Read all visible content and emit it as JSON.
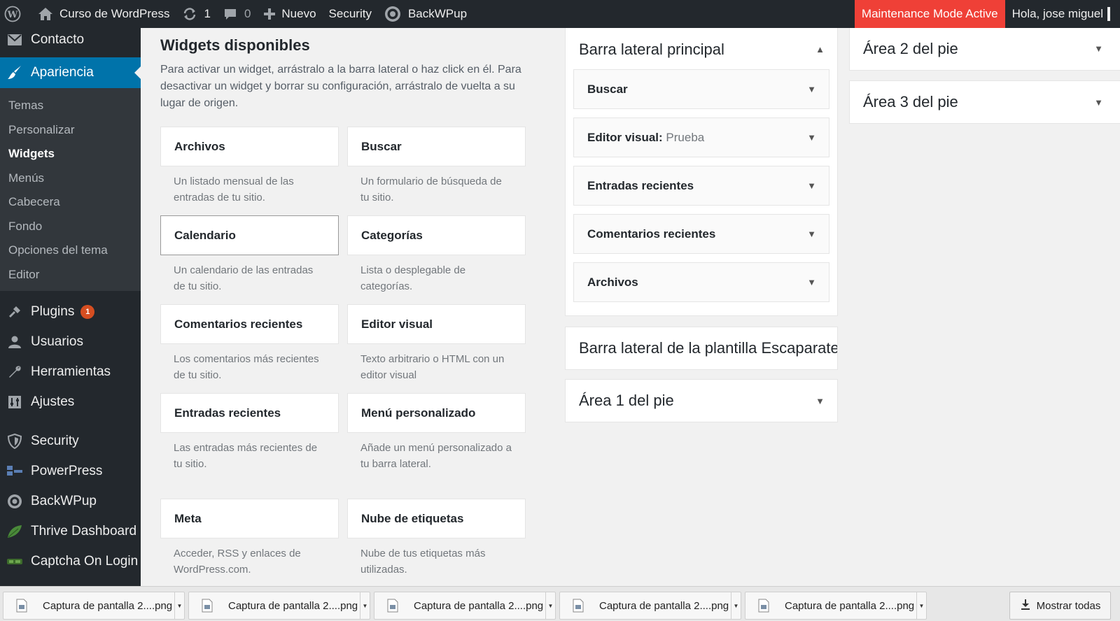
{
  "adminbar": {
    "site_name": "Curso de WordPress",
    "updates_count": "1",
    "comments_count": "0",
    "new_label": "Nuevo",
    "security_label": "Security",
    "backwpup_label": "BackWPup",
    "maintenance_label": "Maintenance Mode Active",
    "howdy": "Hola, jose miguel"
  },
  "sidebar": {
    "contacto": "Contacto",
    "apariencia": "Apariencia",
    "submenu": [
      "Temas",
      "Personalizar",
      "Widgets",
      "Menús",
      "Cabecera",
      "Fondo",
      "Opciones del tema",
      "Editor"
    ],
    "plugins": "Plugins",
    "plugins_badge": "1",
    "usuarios": "Usuarios",
    "herramientas": "Herramientas",
    "ajustes": "Ajustes",
    "security": "Security",
    "powerpress": "PowerPress",
    "backwpup": "BackWPup",
    "thrive": "Thrive Dashboard",
    "captcha": "Captcha On Login"
  },
  "available": {
    "title": "Widgets disponibles",
    "description": "Para activar un widget, arrástralo a la barra lateral o haz click en él. Para desactivar un widget y borrar su configuración, arrástralo de vuelta a su lugar de origen.",
    "widgets": [
      {
        "title": "Archivos",
        "desc": "Un listado mensual de las entradas de tu sitio."
      },
      {
        "title": "Buscar",
        "desc": "Un formulario de búsqueda de tu sitio."
      },
      {
        "title": "Calendario",
        "desc": "Un calendario de las entradas de tu sitio."
      },
      {
        "title": "Categorías",
        "desc": "Lista o desplegable de categorías."
      },
      {
        "title": "Comentarios recientes",
        "desc": "Los comentarios más recientes de tu sitio."
      },
      {
        "title": "Editor visual",
        "desc": "Texto arbitrario o HTML con un editor visual"
      },
      {
        "title": "Entradas recientes",
        "desc": "Las entradas más recientes de tu sitio."
      },
      {
        "title": "Menú personalizado",
        "desc": "Añade un menú personalizado a tu barra lateral."
      },
      {
        "title": "Meta",
        "desc": "Acceder, RSS y enlaces de WordPress.com."
      },
      {
        "title": "Nube de etiquetas",
        "desc": "Nube de tus etiquetas más utilizadas."
      }
    ]
  },
  "sidebars": {
    "principal": {
      "title": "Barra lateral principal",
      "widgets": [
        {
          "title": "Buscar",
          "subtitle": ""
        },
        {
          "title": "Editor visual:",
          "subtitle": "Prueba"
        },
        {
          "title": "Entradas recientes",
          "subtitle": ""
        },
        {
          "title": "Comentarios recientes",
          "subtitle": ""
        },
        {
          "title": "Archivos",
          "subtitle": ""
        }
      ]
    },
    "escaparate": "Barra lateral de la plantilla Escaparate",
    "area1": "Área 1 del pie",
    "area2": "Área 2 del pie",
    "area3": "Área 3 del pie"
  },
  "downloads": {
    "files": [
      "Captura de pantalla 2....png",
      "Captura de pantalla 2....png",
      "Captura de pantalla 2....png",
      "Captura de pantalla 2....png",
      "Captura de pantalla 2....png"
    ],
    "show_all": "Mostrar todas"
  },
  "colors": {
    "adminbar_bg": "#23282d",
    "accent": "#0073aa",
    "maintenance": "#ef4037",
    "badge": "#d54e21"
  }
}
